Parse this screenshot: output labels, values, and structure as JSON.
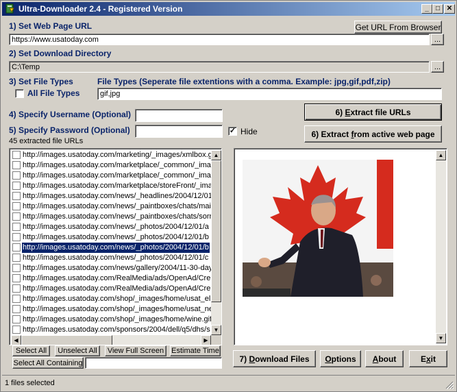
{
  "window": {
    "title": "Ultra-Downloader 2.4 - Registered Version",
    "controls": {
      "minimize": "_",
      "maximize": "□",
      "close": "✕"
    }
  },
  "step1": {
    "label": "1) Set Web Page URL",
    "get_url_button": "Get URL From Browser",
    "url_value": "https://www.usatoday.com",
    "browse_button": "..."
  },
  "step2": {
    "label": "2) Set Download Directory",
    "dir_value": "C:\\Temp",
    "browse_button": "..."
  },
  "step3": {
    "label": "3) Set File Types",
    "all_types_label": "All File Types",
    "all_types_checked": false,
    "file_types_label": "File Types (Seperate file extentions with a comma. Example: jpg,gif,pdf,zip)",
    "file_types_value": "gif,jpg"
  },
  "step4": {
    "label": "4) Specify Username (Optional)",
    "value": ""
  },
  "step5": {
    "label": "5) Specify Password (Optional)",
    "value": "",
    "hide_label": "Hide",
    "hide_checked": true
  },
  "actions": {
    "extract_urls_pre": "6) ",
    "extract_urls_u": "E",
    "extract_urls_post": "xtract file URLs",
    "extract_active_pre": "6) Extract ",
    "extract_active_u": "f",
    "extract_active_post": "rom active web page"
  },
  "list": {
    "count_label": "45 extracted file URLs",
    "items": [
      {
        "text": "http://images.usatoday.com/marketing/_images/xmlbox.gif",
        "selected": false
      },
      {
        "text": "http://images.usatoday.com/marketplace/_common/_images/",
        "selected": false
      },
      {
        "text": "http://images.usatoday.com/marketplace/_common/_images/",
        "selected": false
      },
      {
        "text": "http://images.usatoday.com/marketplace/storeFront/_images/",
        "selected": false
      },
      {
        "text": "http://images.usatoday.com/news/_headlines/2004/12/01/",
        "selected": false
      },
      {
        "text": "http://images.usatoday.com/news/_paintboxes/chats/main",
        "selected": false
      },
      {
        "text": "http://images.usatoday.com/news/_paintboxes/chats/sorry",
        "selected": false
      },
      {
        "text": "http://images.usatoday.com/news/_photos/2004/12/01/a",
        "selected": false
      },
      {
        "text": "http://images.usatoday.com/news/_photos/2004/12/01/b",
        "selected": false
      },
      {
        "text": "http://images.usatoday.com/news/_photos/2004/12/01/b",
        "selected": true
      },
      {
        "text": "http://images.usatoday.com/news/_photos/2004/12/01/c",
        "selected": false
      },
      {
        "text": "http://images.usatoday.com/news/gallery/2004/11-30-day",
        "selected": false
      },
      {
        "text": "http://images.usatoday.com/RealMedia/ads/OpenAd/Cre",
        "selected": false
      },
      {
        "text": "http://images.usatoday.com/RealMedia/ads/OpenAd/Cre",
        "selected": false
      },
      {
        "text": "http://images.usatoday.com/shop/_images/home/usat_el",
        "selected": false
      },
      {
        "text": "http://images.usatoday.com/shop/_images/home/usat_ne",
        "selected": false
      },
      {
        "text": "http://images.usatoday.com/shop/_images/home/wine.gif",
        "selected": false
      },
      {
        "text": "http://images.usatoday.com/sponsors/2004/dell/q5/dhs/s",
        "selected": false
      }
    ]
  },
  "list_buttons": {
    "select_all": "Select All",
    "unselect_all": "Unselect All",
    "view_full": "View Full Screen",
    "estimate": "Estimate Time",
    "select_containing": "Select All Containing",
    "containing_value": ""
  },
  "bottom_buttons": {
    "download_pre": "7) ",
    "download_u": "D",
    "download_post": "ownload Files",
    "options_u": "O",
    "options_post": "ptions",
    "about_u": "A",
    "about_post": "bout",
    "exit_pre": "E",
    "exit_u": "x",
    "exit_post": "it"
  },
  "status": {
    "text": "1 files selected"
  },
  "colors": {
    "title_start": "#0a246a",
    "title_end": "#a6caf0",
    "label_blue": "#0a246a",
    "face": "#d4d0c8",
    "canada_red": "#d52b1e"
  }
}
